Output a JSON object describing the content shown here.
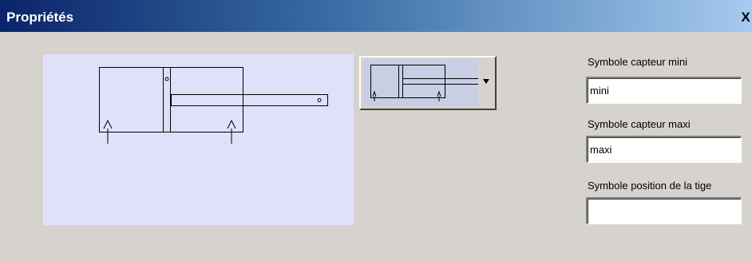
{
  "window": {
    "title": "Propriétés",
    "close_label": "X"
  },
  "combo": {
    "arrow_icon": "chevron-down-icon"
  },
  "fields": [
    {
      "label": "Symbole capteur mini",
      "value": "mini"
    },
    {
      "label": "Symbole capteur maxi",
      "value": "maxi"
    },
    {
      "label": "Symbole position de la tige",
      "value": ""
    }
  ]
}
